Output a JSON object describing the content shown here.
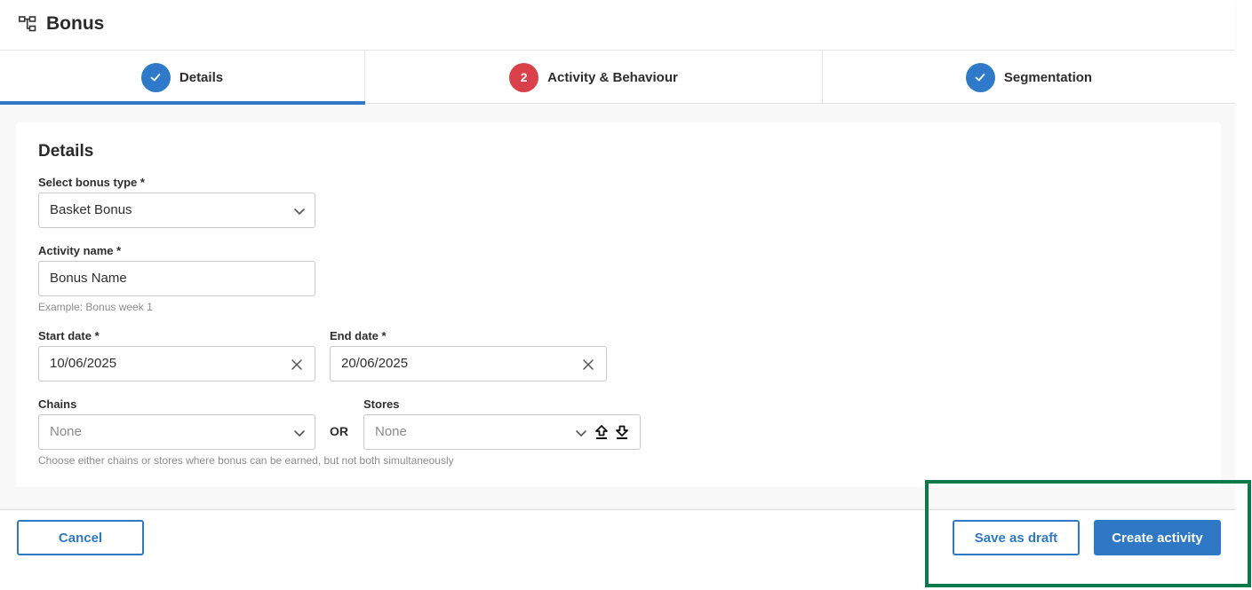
{
  "header": {
    "title": "Bonus",
    "icon": "hierarchy-icon"
  },
  "stepper": {
    "steps": [
      {
        "label": "Details",
        "state": "done",
        "badge": ""
      },
      {
        "label": "Activity & Behaviour",
        "state": "error",
        "badge": "2"
      },
      {
        "label": "Segmentation",
        "state": "done",
        "badge": ""
      }
    ],
    "active_index": 0
  },
  "form": {
    "title": "Details",
    "bonus_type": {
      "label": "Select bonus type *",
      "value": "Basket Bonus"
    },
    "activity_name": {
      "label": "Activity name *",
      "placeholder": "Bonus Name",
      "hint": "Example: Bonus week 1"
    },
    "start_date": {
      "label": "Start date *",
      "value": "10/06/2025"
    },
    "end_date": {
      "label": "End date *",
      "value": "20/06/2025"
    },
    "chains": {
      "label": "Chains",
      "value": "None"
    },
    "or_label": "OR",
    "stores": {
      "label": "Stores",
      "value": "None"
    },
    "location_hint": "Choose either chains or stores where bonus can be earned, but not both simultaneously"
  },
  "footer": {
    "cancel_label": "Cancel",
    "save_draft_label": "Save as draft",
    "create_label": "Create activity"
  },
  "colors": {
    "primary": "#2e78c6",
    "error": "#d9404a",
    "highlight": "#0a7a4a"
  }
}
